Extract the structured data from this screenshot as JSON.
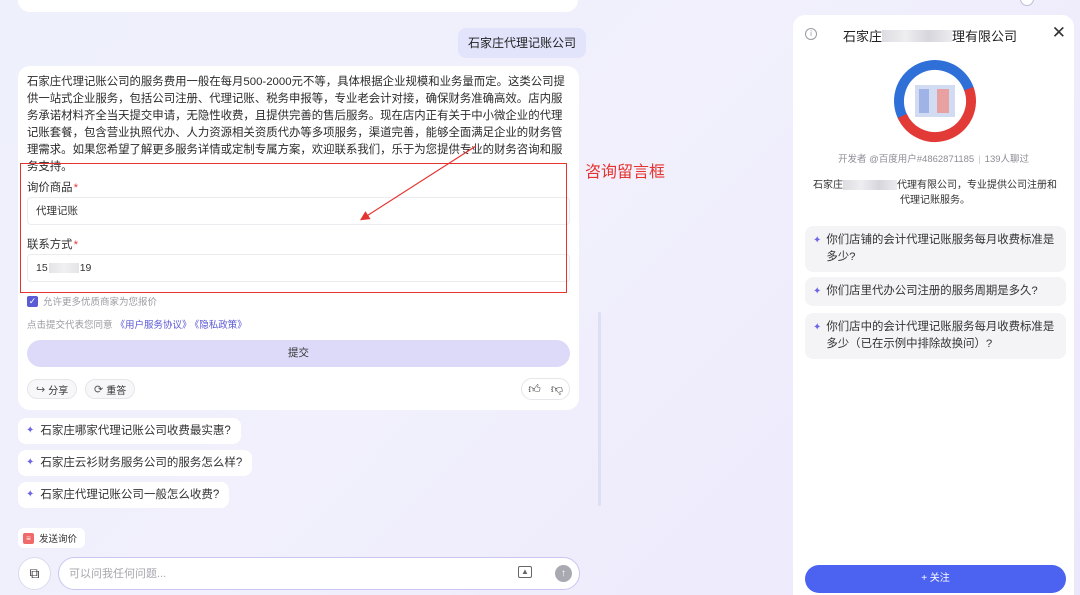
{
  "chat": {
    "user_query": "石家庄代理记账公司",
    "answer_text": "石家庄代理记账公司的服务费用一般在每月500-2000元不等，具体根据企业规模和业务量而定。这类公司提供一站式企业服务，包括公司注册、代理记账、税务申报等，专业老会计对接，确保财务准确高效。店内服务承诺材料齐全当天提交申请，无隐性收费，且提供完善的售后服务。现在店内正有关于中小微企业的代理记账套餐，包含营业执照代办、人力资源相关资质代办等多项服务，渠道完善，能够全面满足企业的财务管理需求。如果您希望了解更多服务详情或定制专属方案，欢迎联系我们，乐于为您提供专业的财务咨询和服务支持。",
    "form": {
      "product_label": "询价商品",
      "product_value": "代理记账",
      "contact_label": "联系方式",
      "contact_prefix": "15",
      "contact_suffix": "19",
      "required_mark": "*",
      "consent_text": "允许更多优质商家为您报价",
      "agreement_prefix": "点击提交代表您同意",
      "agreement_link1": "《用户服务协议》",
      "agreement_link2": "《隐私政策》",
      "submit_label": "提交"
    },
    "actions": {
      "share_label": "分享",
      "regenerate_label": "重答"
    },
    "annotation": "咨询留言框",
    "suggestions": [
      "石家庄哪家代理记账公司收费最实惠?",
      "石家庄云衫财务服务公司的服务怎么样?",
      "石家庄代理记账公司一般怎么收费?"
    ],
    "send_inquiry_label": "发送询价",
    "input_placeholder": "可以问我任何问题..."
  },
  "panel": {
    "title_prefix": "石家庄",
    "title_suffix": "理有限公司",
    "developer_text": "开发者 @百度用户#4862871185",
    "chat_count": "139人聊过",
    "desc_prefix": "石家庄",
    "desc_suffix": "代理有限公司，专业提供公司注册和代理记账服务。",
    "questions": [
      "你们店铺的会计代理记账服务每月收费标准是多少?",
      "你们店里代办公司注册的服务周期是多久?",
      "你们店中的会计代理记账服务每月收费标准是多少（已在示例中排除故换问）?"
    ],
    "follow_label": "+ 关注"
  },
  "colors": {
    "accent": "#5b5bd6",
    "annotation_red": "#e5342f",
    "follow_blue": "#4b63f0",
    "logo_blue": "#2f6fd8",
    "logo_red": "#e23a36"
  },
  "icons": {
    "share": "share-icon",
    "regenerate": "refresh-icon",
    "thumb_up": "thumb-up-icon",
    "thumb_down": "thumb-down-icon",
    "sparkle": "sparkle-icon",
    "image": "image-icon",
    "send": "send-arrow-icon",
    "close": "close-icon",
    "info": "info-icon"
  }
}
